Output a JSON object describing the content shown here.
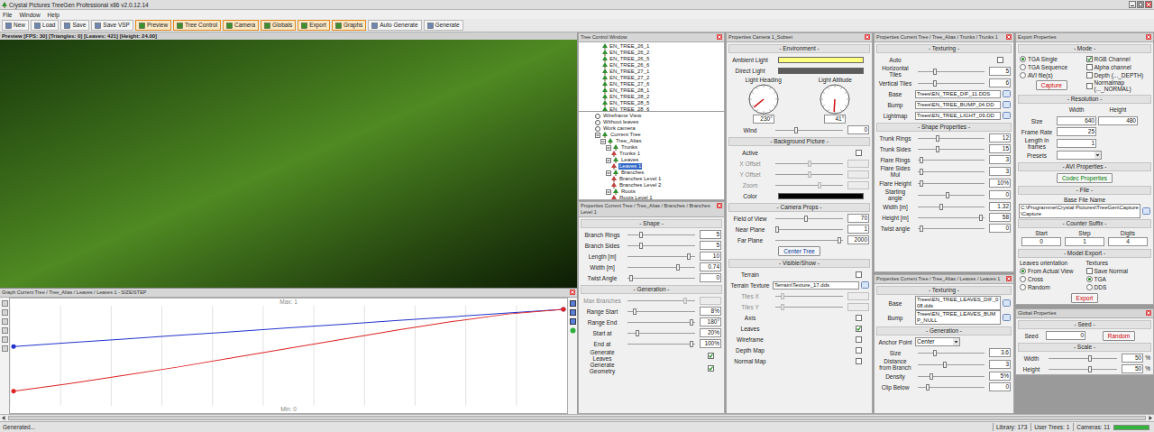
{
  "window": {
    "title": "Crystal Pictures TreeGen Professional x86 v2.0.12.14"
  },
  "menu": [
    "File",
    "Window",
    "Help"
  ],
  "toolbar": [
    {
      "label": "New",
      "selected": false
    },
    {
      "label": "Load",
      "selected": false
    },
    {
      "label": "Save",
      "selected": false
    },
    {
      "label": "Save VSP",
      "selected": false
    },
    {
      "label": "Preview",
      "selected": true
    },
    {
      "label": "Tree Control",
      "selected": true
    },
    {
      "label": "Camera",
      "selected": true
    },
    {
      "label": "Globals",
      "selected": true
    },
    {
      "label": "Export",
      "selected": true
    },
    {
      "label": "Graphs",
      "selected": true
    },
    {
      "label": "Auto Generate",
      "selected": false
    },
    {
      "label": "Generate",
      "selected": false
    }
  ],
  "preview": {
    "title": "Preview [FPS: 30] [Triangles: 0] [Leaves: 421] [Height: 24.00]"
  },
  "graph": {
    "title": "Graph Current Tree / Tree_Alias / Leaves / Leaves 1 - SIZE/STEP",
    "max": "Max: 1",
    "min": "Min: 0",
    "series": [
      {
        "color": "#2233cc",
        "values": [
          0.6,
          0.64,
          0.68,
          0.72,
          0.76,
          0.8,
          0.84,
          0.88,
          0.92,
          0.96,
          1.0
        ]
      },
      {
        "color": "#dd2222",
        "values": [
          0.12,
          0.2,
          0.29,
          0.38,
          0.48,
          0.58,
          0.68,
          0.78,
          0.87,
          0.95,
          1.0
        ]
      }
    ]
  },
  "tree_control": {
    "title": "Tree Control Window",
    "library": [
      "EN_TREE_26_1",
      "EN_TREE_26_2",
      "EN_TREE_26_5",
      "EN_TREE_26_6",
      "EN_TREE_27_1",
      "EN_TREE_27_2",
      "EN_TREE_27_6",
      "EN_TREE_28_1",
      "EN_TREE_28_2",
      "EN_TREE_28_5",
      "EN_TREE_28_6"
    ],
    "scene": [
      {
        "label": "Wireframe View",
        "depth": 0,
        "kind": "option",
        "expanded": false,
        "selected": false
      },
      {
        "label": "Without leaves",
        "depth": 0,
        "kind": "option",
        "expanded": false,
        "selected": false
      },
      {
        "label": "Work camera",
        "depth": 0,
        "kind": "option",
        "expanded": false,
        "selected": false
      },
      {
        "label": "Current Tree",
        "depth": 0,
        "kind": "node",
        "expanded": true,
        "selected": false
      },
      {
        "label": "Tree_Alias",
        "depth": 1,
        "kind": "node",
        "expanded": true,
        "selected": false
      },
      {
        "label": "Trunks",
        "depth": 2,
        "kind": "node",
        "expanded": true,
        "selected": false
      },
      {
        "label": "Trunks 1",
        "depth": 3,
        "kind": "leaf",
        "expanded": false,
        "selected": false
      },
      {
        "label": "Leaves",
        "depth": 2,
        "kind": "node",
        "expanded": true,
        "selected": false
      },
      {
        "label": "Leaves 1",
        "depth": 3,
        "kind": "leaf",
        "expanded": false,
        "selected": true
      },
      {
        "label": "Branches",
        "depth": 2,
        "kind": "node",
        "expanded": true,
        "selected": false
      },
      {
        "label": "Branches Level 1",
        "depth": 3,
        "kind": "leaf",
        "expanded": false,
        "selected": false
      },
      {
        "label": "Branches Level 2",
        "depth": 3,
        "kind": "leaf",
        "expanded": false,
        "selected": false
      },
      {
        "label": "Roots",
        "depth": 2,
        "kind": "node",
        "expanded": true,
        "selected": false
      },
      {
        "label": "Roots Level 1",
        "depth": 3,
        "kind": "leaf",
        "expanded": false,
        "selected": false
      }
    ]
  },
  "branches": {
    "title": "Properties Current Tree / Tree_Alias / Branches / Branches Level 1",
    "sections": [
      {
        "title": "- Shape -",
        "rows": [
          {
            "kind": "slider",
            "label": "Branch Rings",
            "level": 0.2,
            "value": "5",
            "disabled": false
          },
          {
            "kind": "slider",
            "label": "Branch Sides",
            "level": 0.2,
            "value": "5",
            "disabled": false
          },
          {
            "kind": "slider",
            "label": "Length [m]",
            "level": 0.9,
            "value": "10",
            "disabled": false
          },
          {
            "kind": "slider",
            "label": "Width [m]",
            "level": 0.74,
            "value": "0.74",
            "disabled": false
          },
          {
            "kind": "slider",
            "label": "Twist Angle",
            "level": 0.05,
            "value": "0",
            "disabled": false
          }
        ]
      },
      {
        "title": "- Generation -",
        "rows": [
          {
            "kind": "slider",
            "label": "Max Branches",
            "level": 0.85,
            "value": "",
            "disabled": true
          },
          {
            "kind": "slider",
            "label": "Range Start",
            "level": 0.1,
            "value": "8%",
            "disabled": false
          },
          {
            "kind": "slider",
            "label": "Range End",
            "level": 0.95,
            "value": "180°",
            "disabled": false
          },
          {
            "kind": "slider",
            "label": "Start at",
            "level": 0.15,
            "value": "20%",
            "disabled": false
          },
          {
            "kind": "slider",
            "label": "End at",
            "level": 0.95,
            "value": "100%",
            "disabled": false
          },
          {
            "kind": "check",
            "label": "Generate Leaves",
            "checked": true
          },
          {
            "kind": "check",
            "label": "Generate Geometry",
            "checked": true
          }
        ]
      }
    ]
  },
  "camera": {
    "title": "Properties Camera 1_Subset",
    "sections": [
      {
        "title": "- Environment -",
        "rows": [
          {
            "kind": "swatch",
            "label": "Ambient Light",
            "color": "#ffff80"
          },
          {
            "kind": "swatch",
            "label": "Direct Light",
            "color": "#5c5c5c"
          },
          {
            "kind": "dials",
            "items": [
              {
                "label": "Light Heading",
                "value": "230°",
                "level": 0.64
              },
              {
                "label": "Light Altitude",
                "value": "41°",
                "level": 0.51
              }
            ]
          },
          {
            "kind": "slider",
            "label": "Wind",
            "level": 0.3,
            "value": "0",
            "disabled": false
          }
        ]
      },
      {
        "title": "- Background Picture -",
        "rows": [
          {
            "kind": "check",
            "label": "Active",
            "checked": false
          },
          {
            "kind": "slider",
            "label": "X Offset",
            "level": 0.5,
            "value": "",
            "disabled": true
          },
          {
            "kind": "slider",
            "label": "Y Offset",
            "level": 0.5,
            "value": "",
            "disabled": true
          },
          {
            "kind": "slider",
            "label": "Zoom",
            "level": 0.65,
            "value": "",
            "disabled": true
          },
          {
            "kind": "swatch",
            "label": "Color",
            "color": "#000000"
          }
        ]
      },
      {
        "title": "- Camera Props -",
        "rows": [
          {
            "kind": "slider",
            "label": "Field of View",
            "level": 0.45,
            "value": "70",
            "disabled": false
          },
          {
            "kind": "slider",
            "label": "Near Plane",
            "level": 0.02,
            "value": "1",
            "disabled": false
          },
          {
            "kind": "slider",
            "label": "Far Plane",
            "level": 0.95,
            "value": "2000",
            "disabled": false
          },
          {
            "kind": "button",
            "label": "Center Tree",
            "color": "#003399"
          }
        ]
      },
      {
        "title": "- Visible/Show -",
        "rows": [
          {
            "kind": "check",
            "label": "Terrain",
            "checked": false
          },
          {
            "kind": "file",
            "label": "Terrain Texture",
            "value": "Terrain\\Texture_17.dds"
          },
          {
            "kind": "slider",
            "label": "Tiles X",
            "level": 0.1,
            "value": "",
            "disabled": true
          },
          {
            "kind": "slider",
            "label": "Tiles Y",
            "level": 0.1,
            "value": "",
            "disabled": true
          },
          {
            "kind": "check",
            "label": "Axis",
            "checked": false
          },
          {
            "kind": "check",
            "label": "Leaves",
            "checked": true
          },
          {
            "kind": "check",
            "label": "Wireframe",
            "checked": false
          },
          {
            "kind": "check",
            "label": "Depth Map",
            "checked": false
          },
          {
            "kind": "check",
            "label": "Normal Map",
            "checked": false
          }
        ]
      }
    ]
  },
  "trunks": {
    "title": "Properties Current Tree / Tree_Alias / Trunks / Trunks 1",
    "sections": [
      {
        "title": "- Texturing -",
        "rows": [
          {
            "kind": "check",
            "label": "Auto",
            "checked": false
          },
          {
            "kind": "slider",
            "label": "Horizontal Tiles",
            "level": 0.25,
            "value": "5",
            "disabled": false
          },
          {
            "kind": "slider",
            "label": "Vertical Tiles",
            "level": 0.25,
            "value": "6",
            "disabled": false
          },
          {
            "kind": "file",
            "label": "Base",
            "value": "Trees\\EN_TREE_DIF_11.DDS"
          },
          {
            "kind": "file",
            "label": "Bump",
            "value": "Trees\\EN_TREE_BUMP_04.DD"
          },
          {
            "kind": "file",
            "label": "Lightmap",
            "value": "Trees\\EN_TREE_LIGHT_09.DD"
          }
        ]
      },
      {
        "title": "- Shape Properties -",
        "rows": [
          {
            "kind": "slider",
            "label": "Trunk Rings",
            "level": 0.3,
            "value": "12",
            "disabled": false
          },
          {
            "kind": "slider",
            "label": "Trunk Sides",
            "level": 0.3,
            "value": "15",
            "disabled": false
          },
          {
            "kind": "slider",
            "label": "Flare Rings",
            "level": 0.05,
            "value": "3",
            "disabled": false
          },
          {
            "kind": "slider",
            "label": "Flare Sides Mul",
            "level": 0.05,
            "value": "3",
            "disabled": false
          },
          {
            "kind": "slider",
            "label": "Flare Height",
            "level": 0.05,
            "value": "10%",
            "disabled": false
          },
          {
            "kind": "slider",
            "label": "Starting angle",
            "level": 0.45,
            "value": "0",
            "disabled": false
          },
          {
            "kind": "slider",
            "label": "Width [m]",
            "level": 0.35,
            "value": "1.32",
            "disabled": false
          },
          {
            "kind": "slider",
            "label": "Height [m]",
            "level": 0.95,
            "value": "58",
            "disabled": false
          },
          {
            "kind": "slider",
            "label": "Twist angle",
            "level": 0.05,
            "value": "0",
            "disabled": false
          }
        ]
      }
    ]
  },
  "leaves": {
    "title": "Properties Current Tree / Tree_Alias / Leaves / Leaves 1",
    "sections": [
      {
        "title": "- Texturing -",
        "rows": [
          {
            "kind": "file",
            "label": "Base",
            "value": "Trees\\EN_TREE_LEAVES_DIF_008.dds"
          },
          {
            "kind": "file",
            "label": "Bump",
            "value": "Trees\\EN_TREE_LEAVES_BUMP_NULL"
          }
        ]
      },
      {
        "title": "- Generation -",
        "rows": [
          {
            "kind": "select",
            "label": "Anchor Point",
            "value": "Center"
          },
          {
            "kind": "slider",
            "label": "Size",
            "level": 0.25,
            "value": "3.6",
            "disabled": false
          },
          {
            "kind": "slider",
            "label": "Distance from Branch",
            "level": 0.4,
            "value": "3",
            "disabled": false
          },
          {
            "kind": "slider",
            "label": "Density",
            "level": 0.2,
            "value": "5%",
            "disabled": false
          },
          {
            "kind": "slider",
            "label": "Clip Below",
            "level": 0.15,
            "value": "0",
            "disabled": false
          }
        ]
      }
    ]
  },
  "export": {
    "title": "Export Properties",
    "sections": [
      {
        "title": "- Mode -",
        "rows": [
          {
            "kind": "twocol",
            "columns": [
              {
                "items": [
                  {
                    "kind": "radio",
                    "label": "TGA Single",
                    "selected": true
                  },
                  {
                    "kind": "radio",
                    "label": "TGA Sequence",
                    "selected": false
                  },
                  {
                    "kind": "radio",
                    "label": "AVI file(s)",
                    "selected": false
                  },
                  {
                    "kind": "button",
                    "label": "Capture",
                    "color": "#cc0000"
                  }
                ]
              },
              {
                "items": [
                  {
                    "kind": "check",
                    "label": "RGB Channel",
                    "checked": true
                  },
                  {
                    "kind": "check",
                    "label": "Alpha channel",
                    "checked": false
                  },
                  {
                    "kind": "check",
                    "label": "Depth (..._DEPTH)",
                    "checked": false
                  },
                  {
                    "kind": "check",
                    "label": "Normalmap (..._NORMAL)",
                    "checked": false
                  }
                ]
              }
            ]
          }
        ]
      },
      {
        "title": "- Resolution -",
        "rows": [
          {
            "kind": "header",
            "values": [
              "Width",
              "Height"
            ]
          },
          {
            "kind": "inputs",
            "label": "Size",
            "values": [
              "640",
              "480"
            ]
          },
          {
            "kind": "inputs",
            "label": "Frame Rate",
            "values": [
              "25"
            ]
          },
          {
            "kind": "inputs",
            "label": "Length in frames",
            "values": [
              "1"
            ]
          },
          {
            "kind": "select",
            "label": "Presets",
            "value": ""
          }
        ]
      },
      {
        "title": "- AVI Properties -",
        "rows": [
          {
            "kind": "button",
            "label": "Codec Properties",
            "color": "#007a00"
          }
        ]
      },
      {
        "title": "- File -",
        "rows": [
          {
            "kind": "caption",
            "label": "Base File Name"
          },
          {
            "kind": "file",
            "value": "C:\\Programme\\Crystal Pictures\\TreeGen\\Capture\\Capture"
          },
          {
            "kind": "subtitle",
            "label": "- Counter Suffix -"
          },
          {
            "kind": "grid",
            "columns": [
              "Start",
              "Step",
              "Digits"
            ],
            "values": [
              "0",
              "1",
              "4"
            ]
          }
        ]
      },
      {
        "title": "- Model Export -",
        "rows": [
          {
            "kind": "twocol",
            "columns": [
              {
                "title": "Leaves orientation",
                "items": [
                  {
                    "kind": "radio",
                    "label": "From Actual View",
                    "selected": true
                  },
                  {
                    "kind": "radio",
                    "label": "Cross",
                    "selected": false
                  },
                  {
                    "kind": "radio",
                    "label": "Random",
                    "selected": false
                  }
                ]
              },
              {
                "title": "Textures",
                "items": [
                  {
                    "kind": "check",
                    "label": "Save Normal",
                    "checked": false
                  },
                  {
                    "kind": "radio",
                    "label": "TGA",
                    "selected": true
                  },
                  {
                    "kind": "radio",
                    "label": "DDS",
                    "selected": false
                  }
                ]
              }
            ]
          },
          {
            "kind": "button",
            "label": "Export",
            "color": "#cc0000"
          }
        ]
      }
    ]
  },
  "global": {
    "title": "Global Properties",
    "sections": [
      {
        "title": "- Seed -",
        "rows": [
          {
            "kind": "inputbutton",
            "label": "Seed",
            "value": "0",
            "button": "Random",
            "color": "#cc0000"
          }
        ]
      },
      {
        "title": "- Scale -",
        "rows": [
          {
            "kind": "slider",
            "label": "Width",
            "level": 0.6,
            "value": "50",
            "unit": "%",
            "disabled": false
          },
          {
            "kind": "slider",
            "label": "Height",
            "level": 0.6,
            "value": "50",
            "unit": "%",
            "disabled": false
          }
        ]
      }
    ]
  },
  "status_bar": {
    "text": "Generated...",
    "items": [
      "Library: 173",
      "User Trees: 1",
      "Cameras: 11"
    ],
    "progress": 1
  }
}
